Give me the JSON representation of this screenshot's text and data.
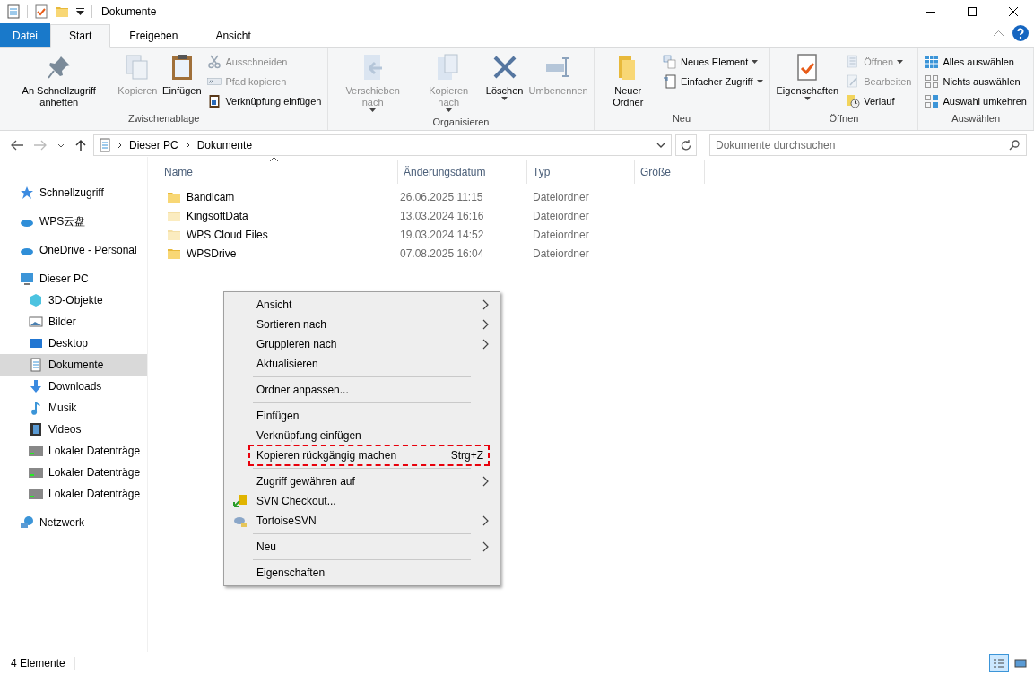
{
  "title_bar": {
    "title": "Dokumente"
  },
  "ribbon_tabs": [
    {
      "label": "Datei",
      "kind": "file",
      "selected": false
    },
    {
      "label": "Start",
      "kind": "tab",
      "selected": true
    },
    {
      "label": "Freigeben",
      "kind": "tab",
      "selected": false
    },
    {
      "label": "Ansicht",
      "kind": "tab",
      "selected": false
    }
  ],
  "ribbon_groups": [
    {
      "label": "Zwischenablage",
      "items": [
        {
          "label": "An Schnellzugriff anheften",
          "kind": "large",
          "disabled": false,
          "dropdown": false
        },
        {
          "label": "Kopieren",
          "kind": "large",
          "disabled": true,
          "dropdown": false
        },
        {
          "label": "Einfügen",
          "kind": "large",
          "disabled": false,
          "dropdown": false
        },
        {
          "label": "Ausschneiden",
          "kind": "small",
          "disabled": true,
          "dropdown": false
        },
        {
          "label": "Pfad kopieren",
          "kind": "small",
          "disabled": true,
          "dropdown": false
        },
        {
          "label": "Verknüpfung einfügen",
          "kind": "small",
          "disabled": false,
          "dropdown": false
        }
      ]
    },
    {
      "label": "Organisieren",
      "items": [
        {
          "label": "Verschieben nach",
          "kind": "large",
          "disabled": true,
          "dropdown": true
        },
        {
          "label": "Kopieren nach",
          "kind": "large",
          "disabled": true,
          "dropdown": true
        },
        {
          "label": "Löschen",
          "kind": "large",
          "disabled": false,
          "dropdown": true
        },
        {
          "label": "Umbenennen",
          "kind": "large",
          "disabled": true,
          "dropdown": false
        }
      ]
    },
    {
      "label": "Neu",
      "items": [
        {
          "label": "Neuer Ordner",
          "kind": "large",
          "disabled": false,
          "dropdown": false
        },
        {
          "label": "Neues Element",
          "kind": "small",
          "disabled": false,
          "dropdown": true
        },
        {
          "label": "Einfacher Zugriff",
          "kind": "small",
          "disabled": false,
          "dropdown": true
        }
      ]
    },
    {
      "label": "Öffnen",
      "items": [
        {
          "label": "Eigenschaften",
          "kind": "large",
          "disabled": false,
          "dropdown": true
        },
        {
          "label": "Öffnen",
          "kind": "small",
          "disabled": true,
          "dropdown": true
        },
        {
          "label": "Bearbeiten",
          "kind": "small",
          "disabled": true,
          "dropdown": false
        },
        {
          "label": "Verlauf",
          "kind": "small",
          "disabled": false,
          "dropdown": false
        }
      ]
    },
    {
      "label": "Auswählen",
      "items": [
        {
          "label": "Alles auswählen",
          "kind": "small",
          "disabled": false,
          "dropdown": false
        },
        {
          "label": "Nichts auswählen",
          "kind": "small",
          "disabled": false,
          "dropdown": false
        },
        {
          "label": "Auswahl umkehren",
          "kind": "small",
          "disabled": false,
          "dropdown": false
        }
      ]
    }
  ],
  "address": {
    "path": [
      "Dieser PC",
      "Dokumente"
    ],
    "search_placeholder": "Dokumente durchsuchen"
  },
  "sidebar": {
    "items": [
      {
        "label": "Schnellzugriff",
        "selected": false
      },
      {
        "label": "WPS云盘",
        "selected": false
      },
      {
        "label": "OneDrive - Personal",
        "selected": false
      },
      {
        "label": "Dieser PC",
        "selected": false,
        "children": [
          {
            "label": "3D-Objekte",
            "selected": false
          },
          {
            "label": "Bilder",
            "selected": false
          },
          {
            "label": "Desktop",
            "selected": false
          },
          {
            "label": "Dokumente",
            "selected": true
          },
          {
            "label": "Downloads",
            "selected": false
          },
          {
            "label": "Musik",
            "selected": false
          },
          {
            "label": "Videos",
            "selected": false
          },
          {
            "label": "Lokaler Datenträge",
            "selected": false
          },
          {
            "label": "Lokaler Datenträge",
            "selected": false
          },
          {
            "label": "Lokaler Datenträge",
            "selected": false
          }
        ]
      },
      {
        "label": "Netzwerk",
        "selected": false
      }
    ]
  },
  "table": {
    "columns": [
      "Name",
      "Änderungsdatum",
      "Typ",
      "Größe"
    ],
    "rows": [
      {
        "name": "Bandicam",
        "date": "26.06.2025 11:15",
        "type": "Dateiordner",
        "hidden": false
      },
      {
        "name": "KingsoftData",
        "date": "13.03.2024 16:16",
        "type": "Dateiordner",
        "hidden": true
      },
      {
        "name": "WPS Cloud Files",
        "date": "19.03.2024 14:52",
        "type": "Dateiordner",
        "hidden": true
      },
      {
        "name": "WPSDrive",
        "date": "07.08.2025 16:04",
        "type": "Dateiordner",
        "hidden": false
      }
    ]
  },
  "context_menu": {
    "items": [
      {
        "kind": "entry",
        "label": "Ansicht",
        "submenu": true,
        "marked": false
      },
      {
        "kind": "entry",
        "label": "Sortieren nach",
        "submenu": true,
        "marked": false
      },
      {
        "kind": "entry",
        "label": "Gruppieren nach",
        "submenu": true,
        "marked": false
      },
      {
        "kind": "entry",
        "label": "Aktualisieren",
        "submenu": false,
        "marked": false
      },
      {
        "kind": "separator"
      },
      {
        "kind": "entry",
        "label": "Ordner anpassen...",
        "submenu": false,
        "marked": false
      },
      {
        "kind": "separator"
      },
      {
        "kind": "entry",
        "label": "Einfügen",
        "submenu": false,
        "marked": false
      },
      {
        "kind": "entry",
        "label": "Verknüpfung einfügen",
        "submenu": false,
        "marked": false
      },
      {
        "kind": "entry",
        "label": "Kopieren rückgängig machen",
        "shortcut": "Strg+Z",
        "submenu": false,
        "marked": true
      },
      {
        "kind": "separator"
      },
      {
        "kind": "entry",
        "label": "Zugriff gewähren auf",
        "submenu": true,
        "marked": false
      },
      {
        "kind": "icon-entry",
        "label": "SVN Checkout...",
        "submenu": false,
        "marked": false
      },
      {
        "kind": "icon-entry",
        "label": "TortoiseSVN",
        "submenu": true,
        "marked": false
      },
      {
        "kind": "separator"
      },
      {
        "kind": "entry",
        "label": "Neu",
        "submenu": true,
        "marked": false
      },
      {
        "kind": "separator"
      },
      {
        "kind": "entry",
        "label": "Eigenschaften",
        "submenu": false,
        "marked": false
      }
    ]
  },
  "status_bar": {
    "count": "4 Elemente",
    "views": [
      {
        "selected": true
      },
      {
        "selected": false
      }
    ]
  }
}
